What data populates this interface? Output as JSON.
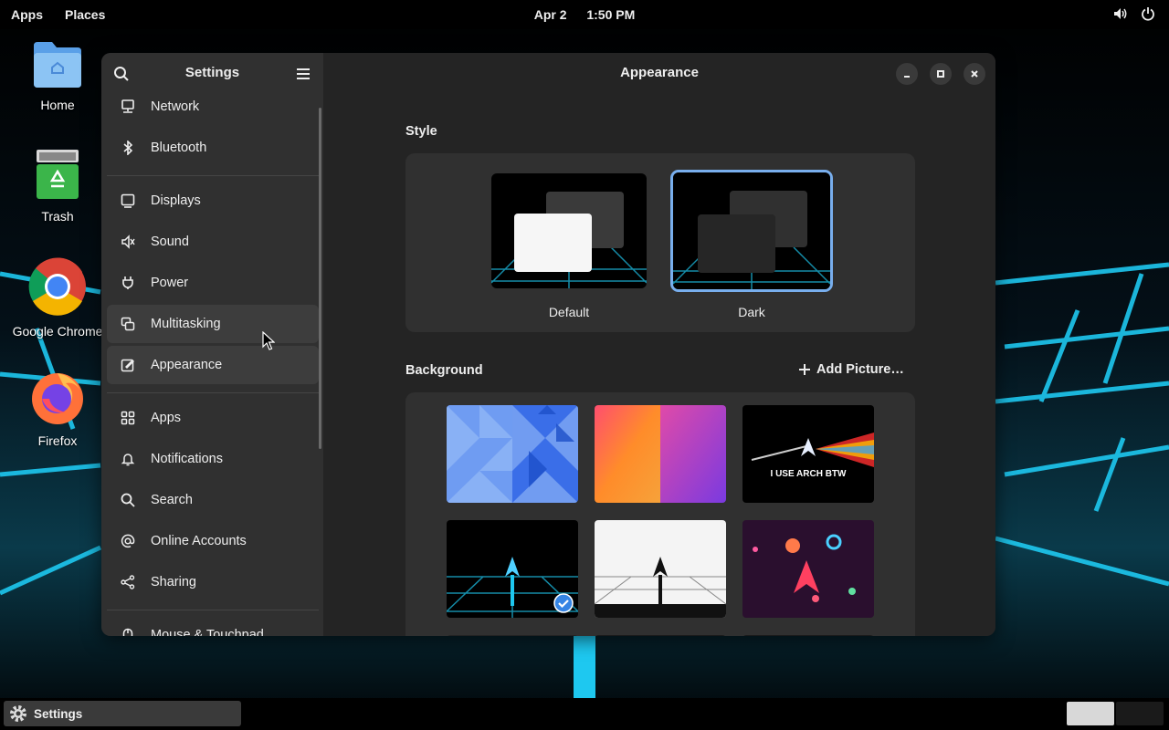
{
  "topbar": {
    "apps_label": "Apps",
    "places_label": "Places",
    "date": "Apr 2",
    "time": "1:50 PM",
    "volume_icon": "volume-icon",
    "power_icon": "power-icon"
  },
  "desktop": {
    "icons": [
      {
        "label": "Home",
        "icon": "home-folder-icon"
      },
      {
        "label": "Trash",
        "icon": "trash-icon"
      },
      {
        "label": "Google Chrome",
        "icon": "chrome-icon"
      },
      {
        "label": "Firefox",
        "icon": "firefox-icon"
      }
    ]
  },
  "settings_window": {
    "sidebar_title": "Settings",
    "content_title": "Appearance",
    "nav_items": [
      {
        "label": "Network",
        "icon": "network-icon"
      },
      {
        "label": "Bluetooth",
        "icon": "bluetooth-icon"
      },
      {
        "label": "Displays",
        "icon": "display-icon"
      },
      {
        "label": "Sound",
        "icon": "sound-icon"
      },
      {
        "label": "Power",
        "icon": "power-plug-icon"
      },
      {
        "label": "Multitasking",
        "icon": "multitasking-icon"
      },
      {
        "label": "Appearance",
        "icon": "appearance-icon"
      },
      {
        "label": "Apps",
        "icon": "apps-grid-icon"
      },
      {
        "label": "Notifications",
        "icon": "bell-icon"
      },
      {
        "label": "Search",
        "icon": "search-icon"
      },
      {
        "label": "Online Accounts",
        "icon": "at-icon"
      },
      {
        "label": "Sharing",
        "icon": "share-icon"
      },
      {
        "label": "Mouse & Touchpad",
        "icon": "mouse-icon"
      }
    ],
    "active_item": "Appearance",
    "hovered_item": "Multitasking",
    "style": {
      "section_label": "Style",
      "options": [
        {
          "label": "Default",
          "selected": false
        },
        {
          "label": "Dark",
          "selected": true
        }
      ]
    },
    "background": {
      "section_label": "Background",
      "add_picture_label": "Add Picture…",
      "thumbnails": [
        {
          "name": "blue-triangles",
          "selected": false
        },
        {
          "name": "orange-purple-gradient",
          "selected": false
        },
        {
          "name": "arch-prism",
          "text": "I USE ARCH BTW",
          "selected": false
        },
        {
          "name": "arch-neon-grid",
          "selected": true
        },
        {
          "name": "arch-white-grid",
          "selected": false
        },
        {
          "name": "arch-planets",
          "selected": false
        }
      ]
    },
    "colors": {
      "accent": "#3584e4",
      "window_bg": "#242424",
      "sidebar_bg": "#303030"
    }
  },
  "taskbar": {
    "task_label": "Settings",
    "task_icon": "gear-icon"
  }
}
